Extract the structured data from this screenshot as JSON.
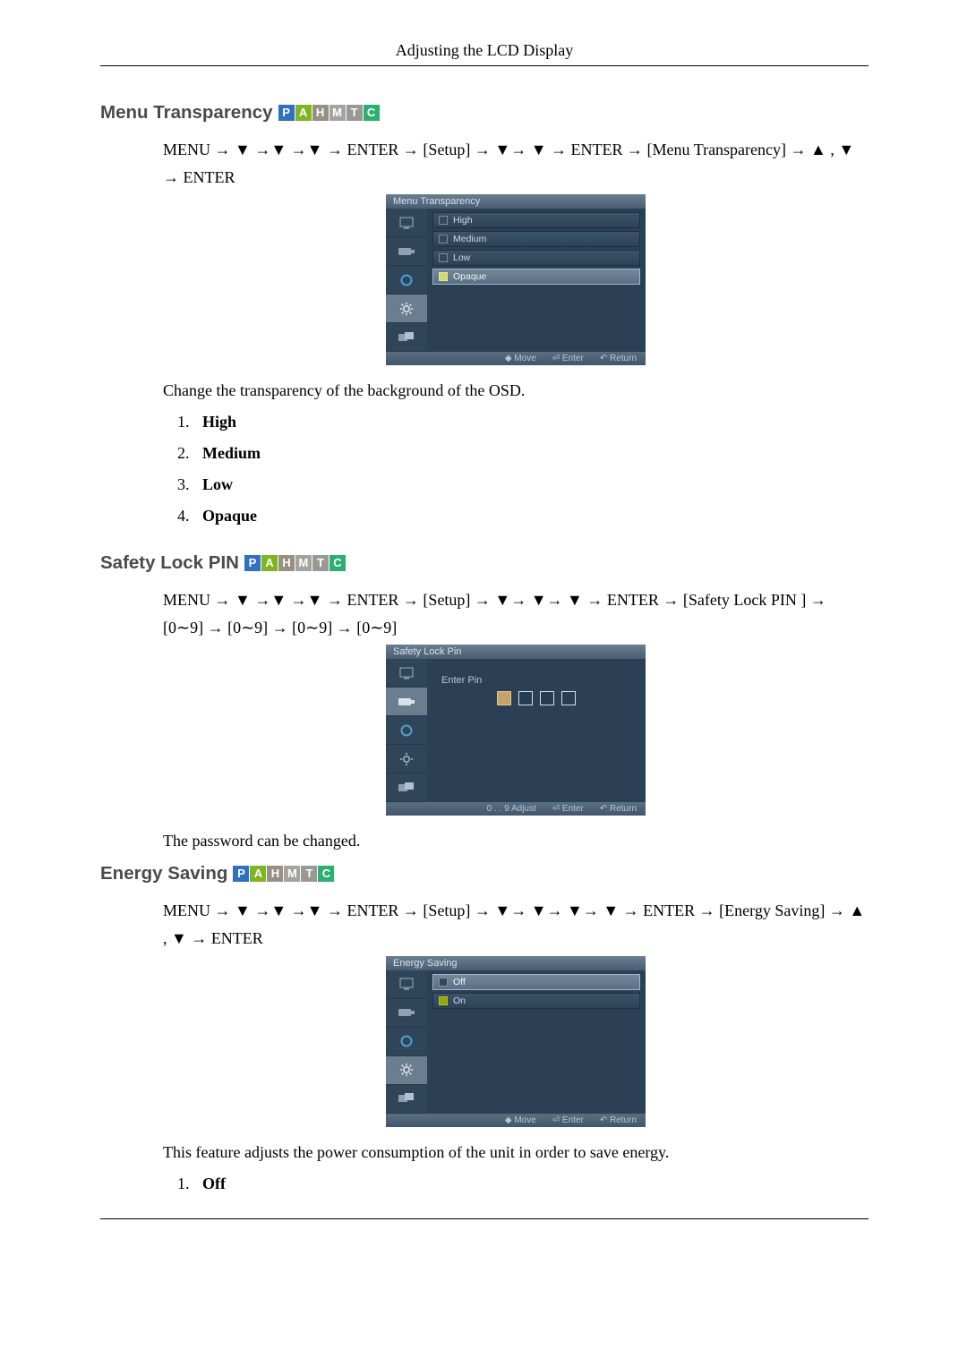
{
  "header": {
    "title": "Adjusting the LCD Display"
  },
  "modes": [
    "P",
    "A",
    "H",
    "M",
    "T",
    "C"
  ],
  "sections": {
    "menu_transparency": {
      "heading": "Menu Transparency",
      "nav": "MENU → ▼ →▼ →▼ → ENTER → [Setup] → ▼→ ▼ → ENTER → [Menu Transparency] → ▲ , ▼ → ENTER",
      "description": "Change the transparency of the background of the OSD.",
      "options": [
        "High",
        "Medium",
        "Low",
        "Opaque"
      ],
      "osd": {
        "title": "Menu Transparency",
        "items": [
          {
            "label": "High",
            "selected": false
          },
          {
            "label": "Medium",
            "selected": false
          },
          {
            "label": "Low",
            "selected": false
          },
          {
            "label": "Opaque",
            "selected": true
          }
        ],
        "footer": [
          "◆ Move",
          "⏎ Enter",
          "↶ Return"
        ]
      }
    },
    "safety_lock": {
      "heading": "Safety Lock PIN",
      "nav": "MENU → ▼ →▼ →▼ → ENTER → [Setup] → ▼→ ▼→ ▼ → ENTER → [Safety Lock PIN ] → [0∼9] → [0∼9] → [0∼9] → [0∼9]",
      "description": "The password can be changed.",
      "osd": {
        "title": "Safety Lock Pin",
        "pin_label": "Enter  Pin",
        "footer": [
          "0 . . 9  Adjust",
          "⏎ Enter",
          "↶ Return"
        ]
      }
    },
    "energy_saving": {
      "heading": "Energy Saving",
      "nav": "MENU → ▼ →▼ →▼ → ENTER → [Setup] → ▼→ ▼→ ▼→ ▼ → ENTER → [Energy Saving] → ▲ , ▼ → ENTER",
      "description": "This feature adjusts the power consumption of the unit in order to save energy.",
      "options": [
        "Off"
      ],
      "osd": {
        "title": "Energy Saving",
        "items": [
          {
            "label": "Off",
            "selected": false
          },
          {
            "label": "On",
            "selected": true
          }
        ],
        "footer": [
          "◆ Move",
          "⏎ Enter",
          "↶ Return"
        ]
      }
    }
  }
}
